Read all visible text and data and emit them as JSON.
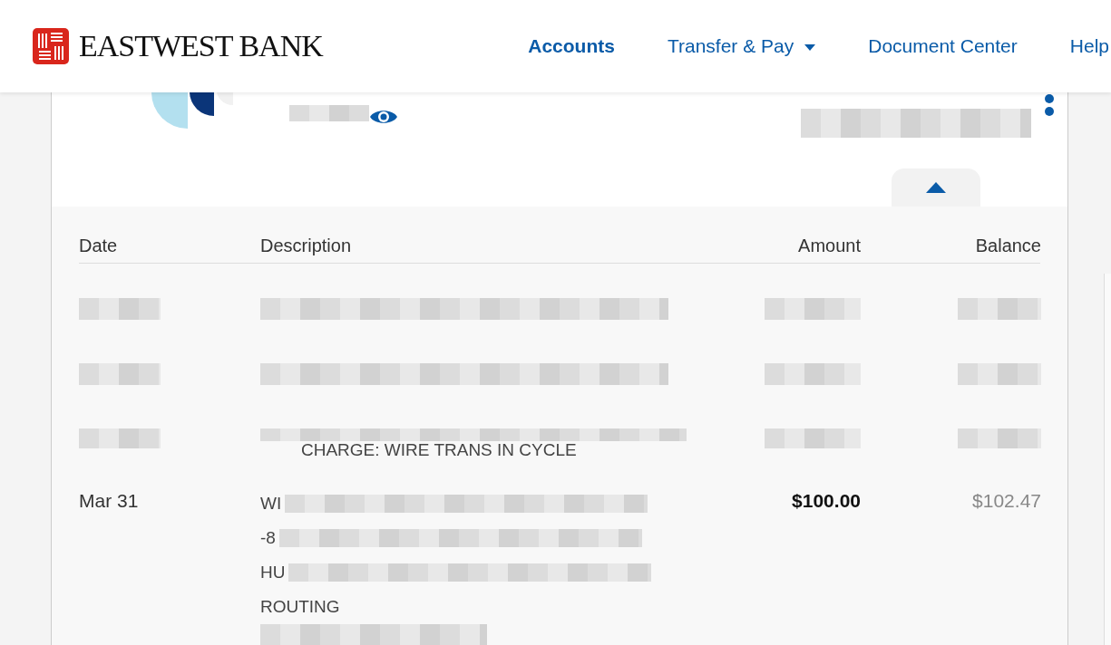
{
  "brand": {
    "name": "EASTWEST BANK"
  },
  "nav": [
    {
      "label": "Accounts",
      "selected": true,
      "dropdown": false
    },
    {
      "label": "Transfer & Pay",
      "selected": false,
      "dropdown": true
    },
    {
      "label": "Document Center",
      "selected": false,
      "dropdown": false
    },
    {
      "label": "Help",
      "selected": false,
      "dropdown": false
    }
  ],
  "table": {
    "columns": [
      "Date",
      "Description",
      "Amount",
      "Balance"
    ],
    "rows": [
      {
        "kind": "redacted"
      },
      {
        "kind": "redacted"
      },
      {
        "kind": "partial",
        "description": "CHARGE: WIRE TRANS IN CYCLE"
      },
      {
        "kind": "full",
        "date": "Mar 31",
        "description_lines": [
          "WI",
          "-8",
          "HU",
          "ROUTING"
        ],
        "amount": "$100.00",
        "balance": "$102.47"
      }
    ]
  }
}
